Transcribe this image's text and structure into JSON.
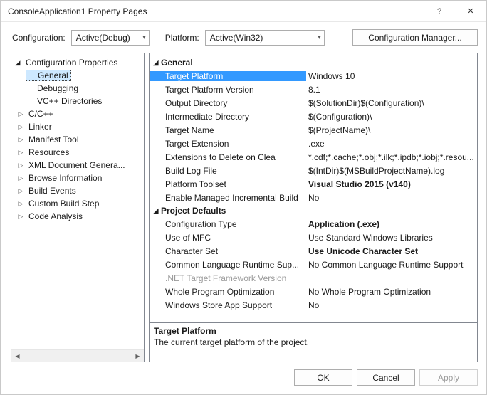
{
  "window": {
    "title": "ConsoleApplication1 Property Pages",
    "help_glyph": "?",
    "close_glyph": "✕"
  },
  "configbar": {
    "configuration_label": "Configuration:",
    "configuration_value": "Active(Debug)",
    "platform_label": "Platform:",
    "platform_value": "Active(Win32)",
    "manager_label": "Configuration Manager..."
  },
  "tree": {
    "root_label": "Configuration Properties",
    "items": [
      {
        "label": "General",
        "expandable": false,
        "selected": true
      },
      {
        "label": "Debugging",
        "expandable": false,
        "selected": false
      },
      {
        "label": "VC++ Directories",
        "expandable": false,
        "selected": false
      },
      {
        "label": "C/C++",
        "expandable": true,
        "selected": false
      },
      {
        "label": "Linker",
        "expandable": true,
        "selected": false
      },
      {
        "label": "Manifest Tool",
        "expandable": true,
        "selected": false
      },
      {
        "label": "Resources",
        "expandable": true,
        "selected": false
      },
      {
        "label": "XML Document Genera...",
        "expandable": true,
        "selected": false
      },
      {
        "label": "Browse Information",
        "expandable": true,
        "selected": false
      },
      {
        "label": "Build Events",
        "expandable": true,
        "selected": false
      },
      {
        "label": "Custom Build Step",
        "expandable": true,
        "selected": false
      },
      {
        "label": "Code Analysis",
        "expandable": true,
        "selected": false
      }
    ]
  },
  "groups": [
    {
      "name": "General",
      "props": [
        {
          "name": "Target Platform",
          "value": "Windows 10",
          "selected": true
        },
        {
          "name": "Target Platform Version",
          "value": "8.1"
        },
        {
          "name": "Output Directory",
          "value": "$(SolutionDir)$(Configuration)\\"
        },
        {
          "name": "Intermediate Directory",
          "value": "$(Configuration)\\"
        },
        {
          "name": "Target Name",
          "value": "$(ProjectName)\\"
        },
        {
          "name": "Target Extension",
          "value": ".exe"
        },
        {
          "name": "Extensions to Delete on Clea",
          "value": "*.cdf;*.cache;*.obj;*.ilk;*.ipdb;*.iobj;*.resou..."
        },
        {
          "name": "Build Log File",
          "value": "$(IntDir)$(MSBuildProjectName).log"
        },
        {
          "name": "Platform Toolset",
          "value": "Visual Studio 2015 (v140)",
          "bold": true
        },
        {
          "name": "Enable Managed Incremental Build",
          "value": "No"
        }
      ]
    },
    {
      "name": "Project Defaults",
      "props": [
        {
          "name": "Configuration Type",
          "value": "Application (.exe)",
          "bold": true
        },
        {
          "name": "Use of MFC",
          "value": "Use Standard Windows Libraries"
        },
        {
          "name": "Character Set",
          "value": "Use Unicode Character Set",
          "bold": true
        },
        {
          "name": "Common Language Runtime Sup...",
          "value": "No Common Language Runtime Support"
        },
        {
          "name": ".NET Target Framework Version",
          "value": "",
          "dim": true
        },
        {
          "name": "Whole Program Optimization",
          "value": "No Whole Program Optimization"
        },
        {
          "name": "Windows Store App Support",
          "value": "No"
        }
      ]
    }
  ],
  "description": {
    "title": "Target Platform",
    "text": "The current target platform of the project."
  },
  "footer": {
    "ok": "OK",
    "cancel": "Cancel",
    "apply": "Apply"
  }
}
